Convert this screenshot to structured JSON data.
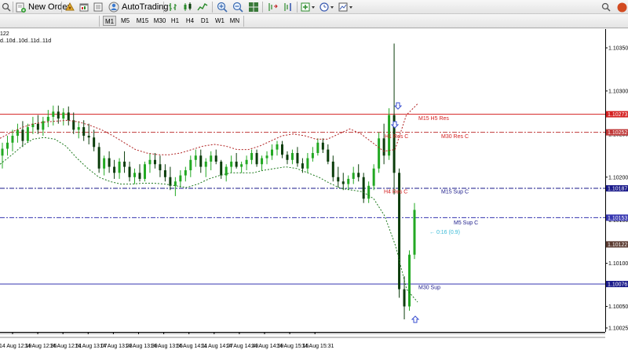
{
  "toolbar": {
    "new_order_label": "New Order",
    "autotrading_label": "AutoTrading"
  },
  "timeframes": [
    "M1",
    "M5",
    "M15",
    "M30",
    "H1",
    "H4",
    "D1",
    "W1",
    "MN"
  ],
  "chart_header": {
    "symbol_fragment": "122",
    "indicator_text": "d..10d..10d..11d..11d"
  },
  "colors": {
    "bull": "#22a822",
    "bear": "#0b3d0b",
    "resistance": "#d42020",
    "resistance_dash": "#c03838",
    "support": "#1a1a8a",
    "support_blue": "#3535b0",
    "band": "#1f7a1f",
    "band_red": "#b02020",
    "cyan": "#36b9d6",
    "arrow": "#3a4fd0",
    "grid": "#e8e8e8"
  },
  "chart_data": {
    "type": "candlestick",
    "x_labels": [
      "14 Aug 12:19",
      "14 Aug 12:35",
      "14 Aug 12:51",
      "14 Aug 13:07",
      "14 Aug 13:23",
      "14 Aug 13:39",
      "14 Aug 13:55",
      "14 Aug 14:11",
      "14 Aug 14:27",
      "14 Aug 14:43",
      "14 Aug 14:59",
      "14 Aug 15:15",
      "14 Aug 15:31"
    ],
    "y_ticks": [
      1.1035,
      1.103,
      1.1025,
      1.102,
      1.1015,
      1.101,
      1.1005,
      1.10025
    ],
    "y_tick_labels": [
      "1.10350",
      "1.10300",
      "1.10250",
      "1.10200",
      "1.10150",
      "1.10100",
      "1.10050",
      "1.10025"
    ],
    "ylim": [
      1.1,
      1.1037
    ],
    "price_levels": [
      {
        "price": 1.10273,
        "label": "1.10273",
        "kind": "res"
      },
      {
        "price": 1.10252,
        "label": "1.10252",
        "kind": "res2"
      },
      {
        "price": 1.10187,
        "label": "1.10187",
        "kind": "sup"
      },
      {
        "price": 1.10153,
        "label": "1.10153",
        "kind": "sup2"
      },
      {
        "price": 1.10122,
        "label": "1.10122",
        "kind": "cur"
      },
      {
        "price": 1.10076,
        "label": "1.10076",
        "kind": "sup"
      }
    ],
    "annotations": [
      {
        "text": "M15 H5 Res",
        "price": 1.10268,
        "kind": "res"
      },
      {
        "text": "M30 Res C",
        "price": 1.10247,
        "kind": "res"
      },
      {
        "text": "H1 Res C",
        "price": 1.10247,
        "kind": "res"
      },
      {
        "text": "H4 Res C",
        "price": 1.10183,
        "kind": "res"
      },
      {
        "text": "M15 Sup C",
        "price": 1.10183,
        "kind": "sup"
      },
      {
        "text": "M5 Sup C",
        "price": 1.10147,
        "kind": "sup"
      },
      {
        "text": "← 0:16 (0.9)",
        "price": 1.10136,
        "kind": "cyan"
      },
      {
        "text": "M30 Sup",
        "price": 1.10072,
        "kind": "sup"
      }
    ],
    "candles": [
      [
        1.10225,
        1.1024,
        1.1021,
        1.10233
      ],
      [
        1.10233,
        1.10248,
        1.10225,
        1.1024
      ],
      [
        1.1024,
        1.10255,
        1.1023,
        1.10248
      ],
      [
        1.10248,
        1.10262,
        1.1024,
        1.10255
      ],
      [
        1.10255,
        1.10265,
        1.10235,
        1.10242
      ],
      [
        1.10242,
        1.10262,
        1.1024,
        1.10258
      ],
      [
        1.10258,
        1.1027,
        1.1025,
        1.10262
      ],
      [
        1.10262,
        1.10272,
        1.1025,
        1.10255
      ],
      [
        1.10255,
        1.1027,
        1.10248,
        1.10265
      ],
      [
        1.10265,
        1.10278,
        1.10258,
        1.1027
      ],
      [
        1.1027,
        1.10283,
        1.1026,
        1.10276
      ],
      [
        1.10276,
        1.10283,
        1.10262,
        1.10268
      ],
      [
        1.10268,
        1.1028,
        1.1026,
        1.10275
      ],
      [
        1.10275,
        1.10282,
        1.1026,
        1.10266
      ],
      [
        1.10266,
        1.10275,
        1.1025,
        1.10255
      ],
      [
        1.10255,
        1.10265,
        1.10245,
        1.10258
      ],
      [
        1.10258,
        1.10266,
        1.10242,
        1.10248
      ],
      [
        1.10248,
        1.10262,
        1.10238,
        1.10246
      ],
      [
        1.10246,
        1.10255,
        1.1023,
        1.10235
      ],
      [
        1.10235,
        1.1024,
        1.10205,
        1.1021
      ],
      [
        1.1021,
        1.10225,
        1.10202,
        1.10222
      ],
      [
        1.10222,
        1.1023,
        1.10205,
        1.10212
      ],
      [
        1.10212,
        1.1022,
        1.10198,
        1.10205
      ],
      [
        1.10205,
        1.10222,
        1.10198,
        1.10218
      ],
      [
        1.10218,
        1.1023,
        1.10205,
        1.10212
      ],
      [
        1.10212,
        1.10218,
        1.10195,
        1.102
      ],
      [
        1.102,
        1.1021,
        1.10192,
        1.10205
      ],
      [
        1.10205,
        1.10215,
        1.10195,
        1.10198
      ],
      [
        1.10198,
        1.10218,
        1.10195,
        1.10215
      ],
      [
        1.10215,
        1.10228,
        1.10205,
        1.1022
      ],
      [
        1.1022,
        1.10228,
        1.1021,
        1.10215
      ],
      [
        1.10215,
        1.10225,
        1.102,
        1.10208
      ],
      [
        1.10208,
        1.10215,
        1.10195,
        1.102
      ],
      [
        1.102,
        1.10212,
        1.10185,
        1.1019
      ],
      [
        1.1019,
        1.102,
        1.10178,
        1.10195
      ],
      [
        1.10195,
        1.10208,
        1.10188,
        1.10202
      ],
      [
        1.10202,
        1.10212,
        1.10195,
        1.10208
      ],
      [
        1.10208,
        1.10225,
        1.102,
        1.1022
      ],
      [
        1.1022,
        1.10232,
        1.10212,
        1.10225
      ],
      [
        1.10225,
        1.10232,
        1.10205,
        1.10212
      ],
      [
        1.10212,
        1.10222,
        1.102,
        1.10218
      ],
      [
        1.10218,
        1.1023,
        1.10208,
        1.10225
      ],
      [
        1.10225,
        1.10232,
        1.10215,
        1.10218
      ],
      [
        1.10218,
        1.1022,
        1.10198,
        1.10202
      ],
      [
        1.10202,
        1.10215,
        1.10195,
        1.10212
      ],
      [
        1.10212,
        1.10225,
        1.10205,
        1.10218
      ],
      [
        1.10218,
        1.10228,
        1.1021,
        1.10212
      ],
      [
        1.10212,
        1.10218,
        1.10205,
        1.10215
      ],
      [
        1.10215,
        1.10225,
        1.10208,
        1.1022
      ],
      [
        1.1022,
        1.10232,
        1.10215,
        1.10228
      ],
      [
        1.10228,
        1.10232,
        1.10212,
        1.10215
      ],
      [
        1.10215,
        1.10225,
        1.10208,
        1.10222
      ],
      [
        1.10222,
        1.1023,
        1.10215,
        1.10225
      ],
      [
        1.10225,
        1.10238,
        1.1022,
        1.10232
      ],
      [
        1.10232,
        1.10242,
        1.10225,
        1.10238
      ],
      [
        1.10238,
        1.10242,
        1.10222,
        1.10226
      ],
      [
        1.10226,
        1.1023,
        1.10215,
        1.1022
      ],
      [
        1.1022,
        1.10232,
        1.10215,
        1.10228
      ],
      [
        1.10228,
        1.10235,
        1.10212,
        1.10216
      ],
      [
        1.10216,
        1.10222,
        1.10205,
        1.1021
      ],
      [
        1.1021,
        1.10228,
        1.10205,
        1.10222
      ],
      [
        1.10222,
        1.10235,
        1.10218,
        1.10228
      ],
      [
        1.10228,
        1.10245,
        1.10225,
        1.1024
      ],
      [
        1.1024,
        1.10245,
        1.10228,
        1.10232
      ],
      [
        1.10232,
        1.10238,
        1.10215,
        1.10218
      ],
      [
        1.10218,
        1.10225,
        1.10195,
        1.102
      ],
      [
        1.102,
        1.10212,
        1.10188,
        1.10195
      ],
      [
        1.10195,
        1.10205,
        1.10185,
        1.10192
      ],
      [
        1.10192,
        1.10202,
        1.10185,
        1.10198
      ],
      [
        1.10198,
        1.10212,
        1.10192,
        1.10205
      ],
      [
        1.10205,
        1.10215,
        1.10195,
        1.102
      ],
      [
        1.102,
        1.10205,
        1.1017,
        1.10175
      ],
      [
        1.10175,
        1.10195,
        1.1017,
        1.1019
      ],
      [
        1.1019,
        1.10215,
        1.10185,
        1.1021
      ],
      [
        1.1021,
        1.10252,
        1.10205,
        1.10245
      ],
      [
        1.10245,
        1.10262,
        1.10215,
        1.10225
      ],
      [
        1.10225,
        1.1028,
        1.1022,
        1.10272
      ],
      [
        1.10272,
        1.10355,
        1.1018,
        1.10205
      ],
      [
        1.10205,
        1.1021,
        1.1006,
        1.1007
      ],
      [
        1.1007,
        1.10085,
        1.10035,
        1.1005
      ],
      [
        1.1005,
        1.10115,
        1.10045,
        1.1011
      ],
      [
        1.1011,
        1.1017,
        1.10105,
        1.10162
      ]
    ],
    "band_red": [
      1.10245,
      1.10252,
      1.10258,
      1.10262,
      1.10264,
      1.10265,
      1.10266,
      1.10264,
      1.1026,
      1.10255,
      1.10248,
      1.1024,
      1.10232,
      1.10228,
      1.10226,
      1.10226,
      1.10228,
      1.10232,
      1.10236,
      1.10238,
      1.10236,
      1.10232,
      1.10232,
      1.10236,
      1.10242,
      1.10248,
      1.1025,
      1.10248,
      1.10244,
      1.10244,
      1.1025,
      1.10256,
      1.1025,
      1.1024,
      1.1023,
      1.10232,
      1.10272,
      1.10285
    ],
    "band_green": [
      1.10215,
      1.10225,
      1.10236,
      1.10244,
      1.10246,
      1.10244,
      1.10236,
      1.10222,
      1.1021,
      1.102,
      1.10195,
      1.10192,
      1.10192,
      1.10193,
      1.10193,
      1.10192,
      1.1019,
      1.10188,
      1.10192,
      1.10198,
      1.10202,
      1.10205,
      1.10205,
      1.10205,
      1.10208,
      1.1021,
      1.10212,
      1.1021,
      1.10205,
      1.102,
      1.10193,
      1.10187,
      1.10185,
      1.10183,
      1.10175,
      1.10155,
      1.1012,
      1.1007,
      1.10055
    ]
  }
}
